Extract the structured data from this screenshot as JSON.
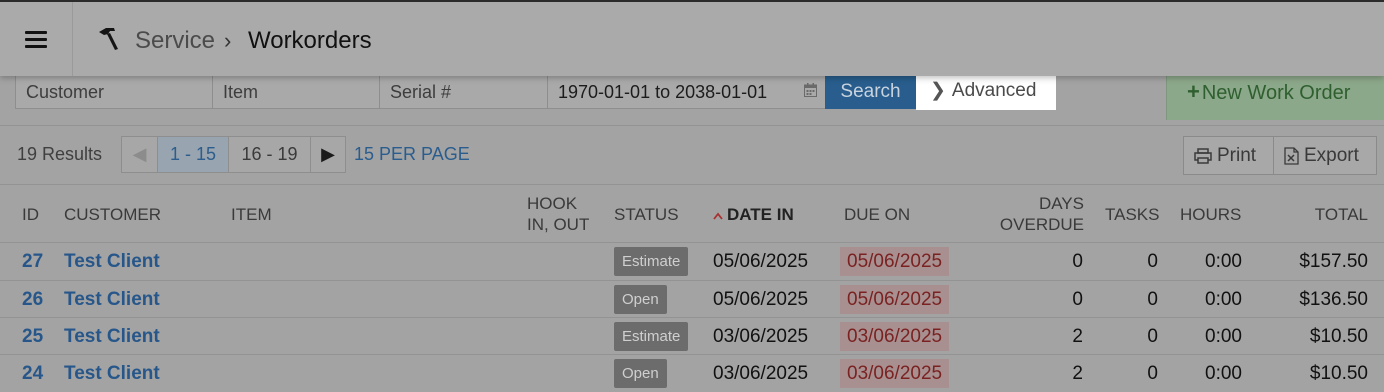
{
  "header": {
    "breadcrumb_parent": "Service",
    "breadcrumb_sep": "›",
    "breadcrumb_current": "Workorders"
  },
  "filters": {
    "customer_placeholder": "Customer",
    "item_placeholder": "Item",
    "serial_placeholder": "Serial #",
    "date_range": "1970-01-01 to 2038-01-01",
    "search_label": "Search",
    "advanced_label": "Advanced",
    "new_label": "New Work Order"
  },
  "toolbar": {
    "results": "19 Results",
    "pages": [
      "1 - 15",
      "16 - 19"
    ],
    "current_page": "1 - 15",
    "per_page": "15 PER PAGE",
    "print_label": "Print",
    "export_label": "Export"
  },
  "columns": {
    "id": "ID",
    "customer": "CUSTOMER",
    "item": "ITEM",
    "hook_1": "HOOK",
    "hook_2": "IN, OUT",
    "status": "STATUS",
    "date_in": "DATE IN",
    "due_on": "DUE ON",
    "days_1": "DAYS",
    "days_2": "OVERDUE",
    "tasks": "TASKS",
    "hours": "HOURS",
    "total": "TOTAL"
  },
  "rows": [
    {
      "id": "27",
      "customer": "Test Client",
      "status": "Estimate",
      "date_in": "05/06/2025",
      "due_on": "05/06/2025",
      "days_overdue": "0",
      "tasks": "0",
      "hours": "0:00",
      "total": "$157.50"
    },
    {
      "id": "26",
      "customer": "Test Client",
      "status": "Open",
      "date_in": "05/06/2025",
      "due_on": "05/06/2025",
      "days_overdue": "0",
      "tasks": "0",
      "hours": "0:00",
      "total": "$136.50"
    },
    {
      "id": "25",
      "customer": "Test Client",
      "status": "Estimate",
      "date_in": "03/06/2025",
      "due_on": "03/06/2025",
      "days_overdue": "2",
      "tasks": "0",
      "hours": "0:00",
      "total": "$10.50"
    },
    {
      "id": "24",
      "customer": "Test Client",
      "status": "Open",
      "date_in": "03/06/2025",
      "due_on": "03/06/2025",
      "days_overdue": "2",
      "tasks": "0",
      "hours": "0:00",
      "total": "$10.50"
    }
  ],
  "colors": {
    "link": "#27578a",
    "search_button": "#285d8d",
    "new_button": "#8ca88a",
    "overdue_bg": "#a89090",
    "overdue_text": "#7a2222"
  },
  "icons": [
    "menu-icon",
    "hammer-icon",
    "calendar-icon",
    "chevron-right-icon",
    "plus-icon",
    "caret-left-icon",
    "caret-right-icon",
    "printer-icon",
    "excel-icon",
    "sort-up-icon"
  ]
}
